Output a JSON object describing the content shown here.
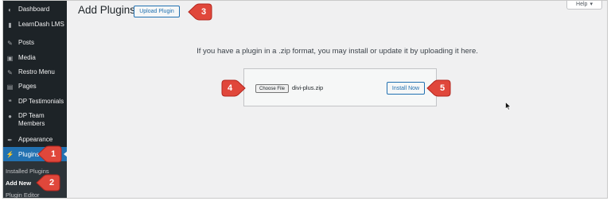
{
  "sidebar": {
    "items": [
      {
        "label": "Dashboard",
        "icon": "dashboard-icon",
        "glyph": "◐"
      },
      {
        "label": "LearnDash LMS",
        "icon": "learndash-icon",
        "glyph": "▮"
      },
      {
        "label": "Posts",
        "icon": "pin-icon",
        "glyph": "✎"
      },
      {
        "label": "Media",
        "icon": "media-icon",
        "glyph": "▣"
      },
      {
        "label": "Restro Menu",
        "icon": "pin-icon",
        "glyph": "✎"
      },
      {
        "label": "Pages",
        "icon": "pages-icon",
        "glyph": "▤"
      },
      {
        "label": "DP Testimonials",
        "icon": "quote-icon",
        "glyph": "❝"
      },
      {
        "label": "DP Team Members",
        "icon": "person-icon",
        "glyph": "●"
      },
      {
        "label": "Appearance",
        "icon": "brush-icon",
        "glyph": "✒"
      }
    ],
    "active": {
      "label": "Plugins",
      "icon": "plugins-icon",
      "glyph": "⚡"
    },
    "submenu": [
      "Installed Plugins",
      "Add New",
      "Plugin Editor"
    ]
  },
  "header": {
    "title": "Add Plugins",
    "upload_button": "Upload Plugin",
    "help": "Help"
  },
  "main": {
    "info_text": "If you have a plugin in a .zip format, you may install or update it by uploading it here.",
    "choose_file": "Choose File",
    "file_name": "divi-plus.zip",
    "install_button": "Install Now"
  },
  "callouts": [
    "1",
    "2",
    "3",
    "4",
    "5"
  ],
  "colors": {
    "sidebar_bg": "#1d2327",
    "accent": "#2271b1",
    "callout": "#e74c3c",
    "page_bg": "#f0f0f1"
  }
}
